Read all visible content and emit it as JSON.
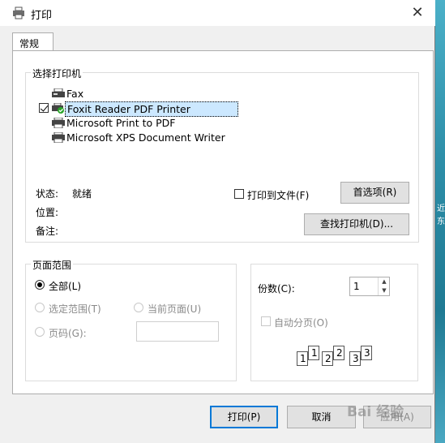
{
  "window": {
    "title": "打印",
    "close_glyph": "✕"
  },
  "tab": {
    "label": "常规"
  },
  "printer_group": {
    "label": "选择打印机",
    "printers": [
      {
        "name": "Fax",
        "selected": false
      },
      {
        "name": "Foxit Reader PDF Printer",
        "selected": true
      },
      {
        "name": "Microsoft Print to PDF",
        "selected": false
      },
      {
        "name": "Microsoft XPS Document Writer",
        "selected": false
      }
    ],
    "status_label": "状态:",
    "status_value": "就绪",
    "location_label": "位置:",
    "comment_label": "备注:",
    "print_to_file_label": "打印到文件(F)",
    "preferences_button": "首选项(R)",
    "find_printer_button": "查找打印机(D)..."
  },
  "page_range": {
    "label": "页面范围",
    "all_label": "全部(L)",
    "selection_label": "选定范围(T)",
    "current_page_label": "当前页面(U)",
    "pages_label": "页码(G):",
    "pages_value": ""
  },
  "copies": {
    "label": "份数(C):",
    "value": "1",
    "collate_label": "自动分页(O)",
    "collate_icon_numbers": [
      "1",
      "1",
      "2",
      "2",
      "3",
      "3"
    ]
  },
  "buttons": {
    "print": "打印(P)",
    "cancel": "取消",
    "apply": "应用(A)"
  },
  "watermark": "Bai 经验",
  "desktop_glyphs": [
    "近",
    "东"
  ]
}
